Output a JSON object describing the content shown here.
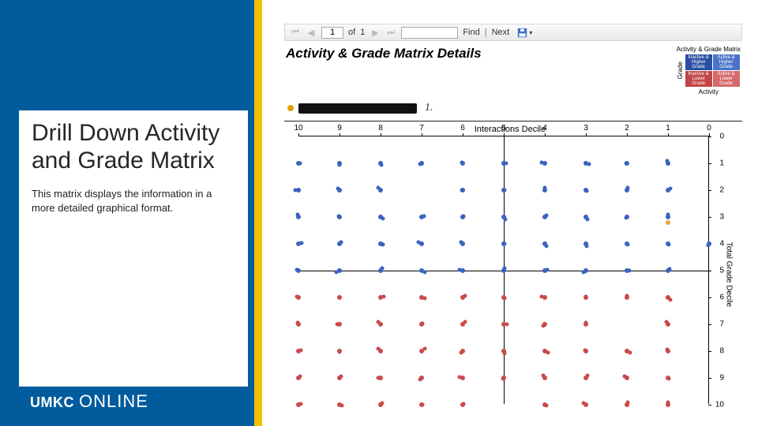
{
  "sidebar": {
    "title": "Drill Down Activity and Grade Matrix",
    "description": "This matrix displays the information in a more detailed graphical format.",
    "logo_mark": "UMKC",
    "logo_text": "ONLINE"
  },
  "toolbar": {
    "page_value": "1",
    "of_label": "of",
    "page_count": "1",
    "find_placeholder": "",
    "find_label": "Find",
    "next_label": "Next"
  },
  "report": {
    "title": "Activity & Grade Matrix Details",
    "legend_title": "Activity & Grade Matrix",
    "legend_x": "Activity",
    "legend_y": "Grade",
    "legend_cells": [
      "Inactive & Higher Grade",
      "Active & Higher Grade",
      "Inactive & Lower Grade",
      "Active & Lower Grade"
    ],
    "enum": "1."
  },
  "chart_data": {
    "type": "scatter",
    "title": "Interactions Decile",
    "xlabel": "Interactions Decile",
    "ylabel": "Total Grade Decile",
    "x_ticks": [
      10,
      9,
      8,
      7,
      6,
      5,
      4,
      3,
      2,
      1,
      0
    ],
    "y_ticks": [
      0,
      1,
      2,
      3,
      4,
      5,
      6,
      7,
      8,
      9,
      10
    ],
    "xlim": [
      10,
      0
    ],
    "ylim": [
      0,
      10
    ],
    "series": [
      {
        "name": "upper-blue",
        "color": "#3a62c0",
        "points": [
          [
            10,
            1
          ],
          [
            9,
            1
          ],
          [
            8,
            1
          ],
          [
            7,
            1
          ],
          [
            6,
            1
          ],
          [
            5,
            1
          ],
          [
            4,
            1
          ],
          [
            3,
            1
          ],
          [
            2,
            1
          ],
          [
            1,
            1
          ],
          [
            10,
            2
          ],
          [
            9,
            2
          ],
          [
            8,
            2
          ],
          [
            6,
            2
          ],
          [
            5,
            2
          ],
          [
            4,
            2
          ],
          [
            3,
            2
          ],
          [
            2,
            2
          ],
          [
            1,
            2
          ],
          [
            10,
            3
          ],
          [
            9,
            3
          ],
          [
            8,
            3
          ],
          [
            7,
            3
          ],
          [
            6,
            3
          ],
          [
            5,
            3
          ],
          [
            4,
            3
          ],
          [
            3,
            3
          ],
          [
            2,
            3
          ],
          [
            1,
            3
          ],
          [
            10,
            4
          ],
          [
            9,
            4
          ],
          [
            8,
            4
          ],
          [
            7,
            4
          ],
          [
            6,
            4
          ],
          [
            5,
            4
          ],
          [
            4,
            4
          ],
          [
            3,
            4
          ],
          [
            2,
            4
          ],
          [
            1,
            4
          ],
          [
            0,
            4
          ],
          [
            10,
            5
          ],
          [
            9,
            5
          ],
          [
            8,
            5
          ],
          [
            7,
            5
          ],
          [
            6,
            5
          ],
          [
            5,
            5
          ],
          [
            4,
            5
          ],
          [
            3,
            5
          ],
          [
            2,
            5
          ],
          [
            1,
            5
          ]
        ]
      },
      {
        "name": "lower-red",
        "color": "#c94a4a",
        "points": [
          [
            10,
            6
          ],
          [
            9,
            6
          ],
          [
            8,
            6
          ],
          [
            7,
            6
          ],
          [
            6,
            6
          ],
          [
            5,
            6
          ],
          [
            4,
            6
          ],
          [
            3,
            6
          ],
          [
            2,
            6
          ],
          [
            1,
            6
          ],
          [
            10,
            7
          ],
          [
            9,
            7
          ],
          [
            8,
            7
          ],
          [
            7,
            7
          ],
          [
            6,
            7
          ],
          [
            5,
            7
          ],
          [
            4,
            7
          ],
          [
            3,
            7
          ],
          [
            1,
            7
          ],
          [
            10,
            8
          ],
          [
            9,
            8
          ],
          [
            8,
            8
          ],
          [
            7,
            8
          ],
          [
            6,
            8
          ],
          [
            5,
            8
          ],
          [
            4,
            8
          ],
          [
            3,
            8
          ],
          [
            2,
            8
          ],
          [
            1,
            8
          ],
          [
            10,
            9
          ],
          [
            9,
            9
          ],
          [
            8,
            9
          ],
          [
            7,
            9
          ],
          [
            6,
            9
          ],
          [
            5,
            9
          ],
          [
            4,
            9
          ],
          [
            3,
            9
          ],
          [
            2,
            9
          ],
          [
            1,
            9
          ],
          [
            10,
            10
          ],
          [
            9,
            10
          ],
          [
            8,
            10
          ],
          [
            7,
            10
          ],
          [
            6,
            10
          ],
          [
            4,
            10
          ],
          [
            3,
            10
          ],
          [
            2,
            10
          ],
          [
            1,
            10
          ]
        ]
      },
      {
        "name": "highlight",
        "color": "#e9a83a",
        "points": [
          [
            1,
            3.2
          ]
        ]
      }
    ]
  }
}
